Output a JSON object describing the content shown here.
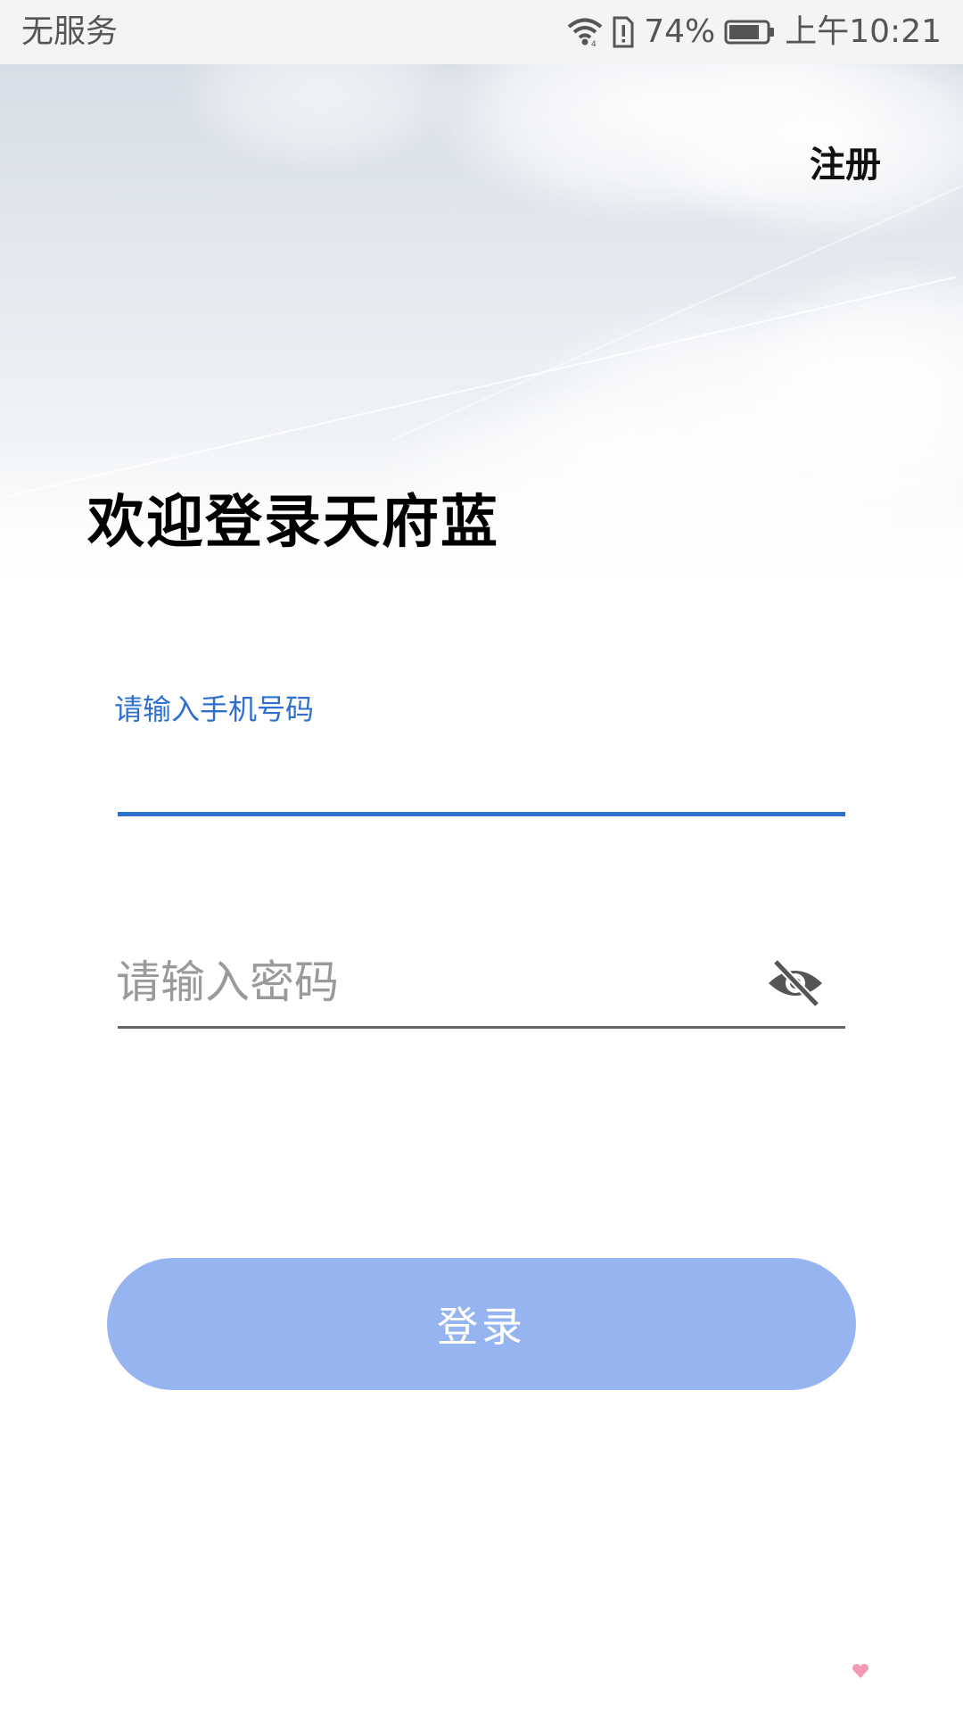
{
  "status_bar": {
    "carrier": "无服务",
    "battery_percent": "74%",
    "time": "上午10:21",
    "icons": [
      "wifi-icon",
      "sim-alert-icon",
      "battery-icon"
    ]
  },
  "header": {
    "register_label": "注册",
    "welcome_title": "欢迎登录天府蓝"
  },
  "form": {
    "phone": {
      "label": "请输入手机号码",
      "value": ""
    },
    "password": {
      "placeholder": "请输入密码",
      "value": "",
      "toggle_icon": "eye-off-icon"
    },
    "login_label": "登录"
  },
  "colors": {
    "accent": "#2f6fd0",
    "login_button": "#96b5f0",
    "status_bar_bg": "#f4f4f4"
  }
}
